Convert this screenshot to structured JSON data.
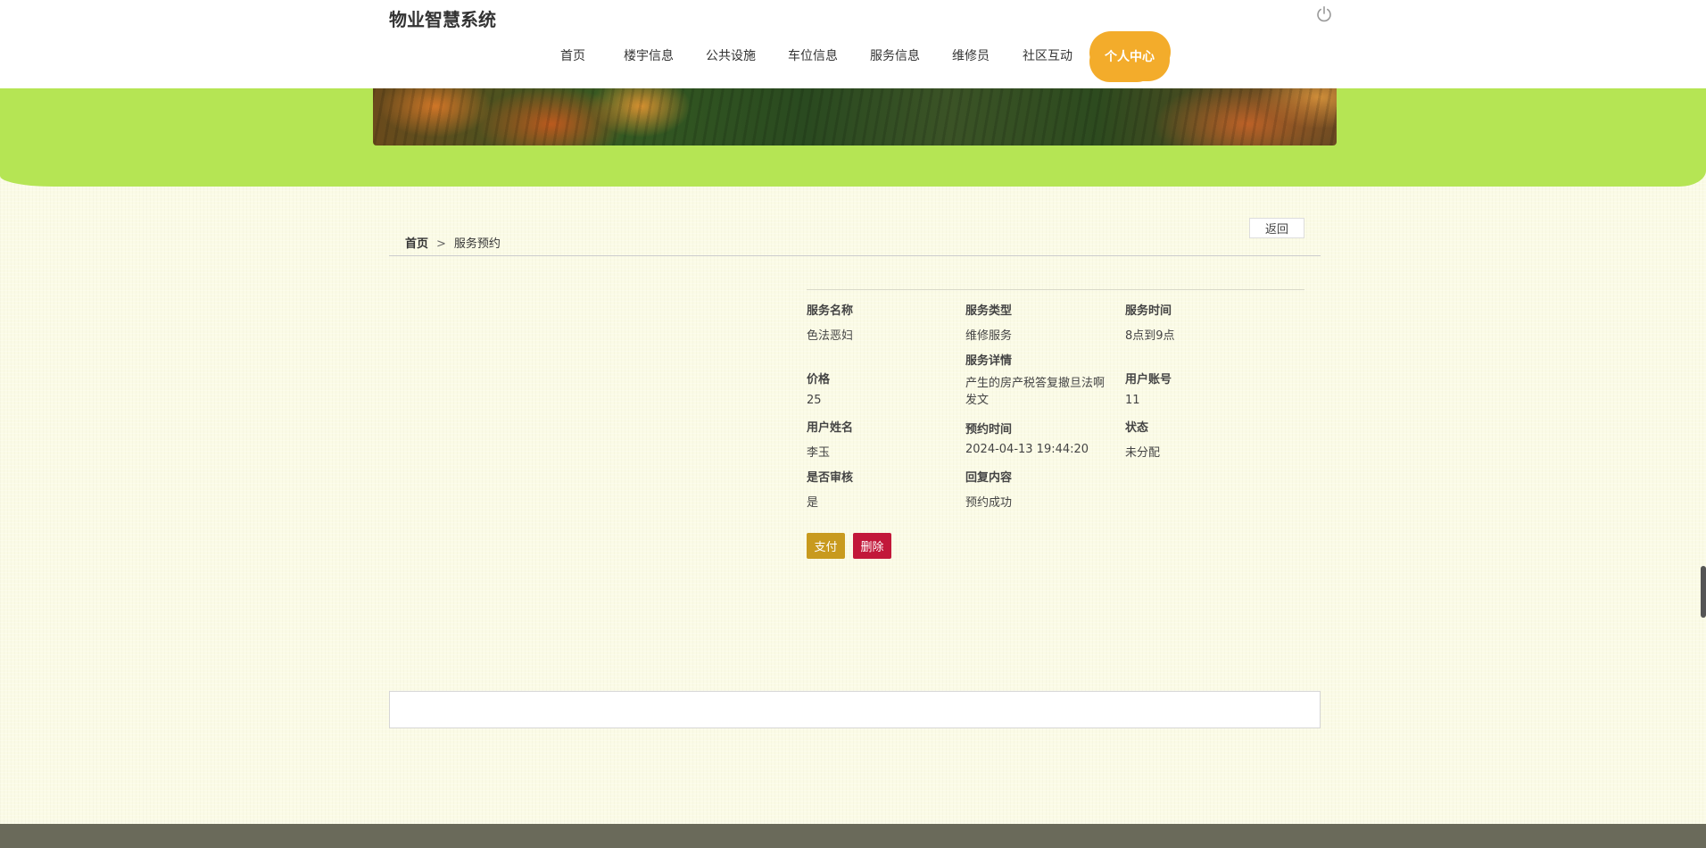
{
  "header": {
    "site_title": "物业智慧系统",
    "nav": [
      "首页",
      "楼宇信息",
      "公共设施",
      "车位信息",
      "服务信息",
      "维修员",
      "社区互动"
    ],
    "personal_center": "个人中心",
    "power_icon": "power-icon"
  },
  "breadcrumb": {
    "home": "首页",
    "separator": ">",
    "current": "服务预约"
  },
  "back_label": "返回",
  "detail": {
    "service_name_label": "服务名称",
    "service_name": "色法恶妇",
    "service_type_label": "服务类型",
    "service_type": "维修服务",
    "service_time_label": "服务时间",
    "service_time": "8点到9点",
    "service_detail_label": "服务详情",
    "service_detail": "产生的房产税答复撤旦法啊发文",
    "price_label": "价格",
    "price": "25",
    "user_account_label": "用户账号",
    "user_account": "11",
    "user_name_label": "用户姓名",
    "user_name": "李玉",
    "booking_time_label": "预约时间",
    "booking_time": "2024-04-13 19:44:20",
    "status_label": "状态",
    "status": "未分配",
    "audited_label": "是否审核",
    "audited": "是",
    "reply_label": "回复内容",
    "reply": "预约成功"
  },
  "actions": {
    "pay": "支付",
    "delete": "删除"
  },
  "colors": {
    "accent_orange": "#f3ac2b",
    "green_band": "#b5e554",
    "pay": "#c89a1e",
    "delete": "#c2183a",
    "footer": "#6a6a5a"
  }
}
